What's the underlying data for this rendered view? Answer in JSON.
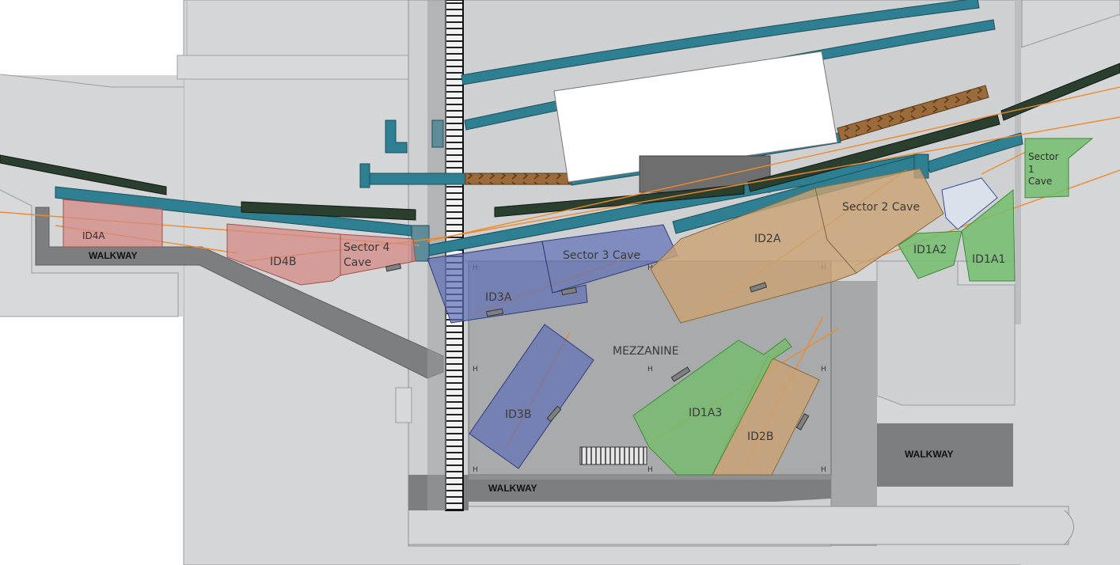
{
  "labels": {
    "id4a": "ID4A",
    "id4b": "ID4B",
    "sector4_line1": "Sector 4",
    "sector4_line2": "Cave",
    "id3a": "ID3A",
    "sector3": "Sector 3 Cave",
    "id3b": "ID3B",
    "mezzanine": "MEZZANINE",
    "id2a": "ID2A",
    "sector2": "Sector 2 Cave",
    "id2b": "ID2B",
    "id1a3": "ID1A3",
    "id1a2": "ID1A2",
    "id1a1": "ID1A1",
    "sector1_line1": "Sector",
    "sector1_line2": "1",
    "sector1_line3": "Cave"
  },
  "walkways": {
    "left": "WALKWAY",
    "center": "WALKWAY",
    "right": "WALKWAY"
  },
  "colors": {
    "floor": "#d5d6d8",
    "floor_dark": "#b9babc",
    "walkway": "#7d7e80",
    "mezzanine": "#a9aaac",
    "beamline": "#2f7f92",
    "transport_brown": "#9c6b3c",
    "hutch_red": "#d38a86",
    "hutch_blue": "#5e6fb5",
    "hutch_tan": "#c9a374",
    "hutch_green": "#73bd6e",
    "beam_orange": "#ee8a2a"
  }
}
